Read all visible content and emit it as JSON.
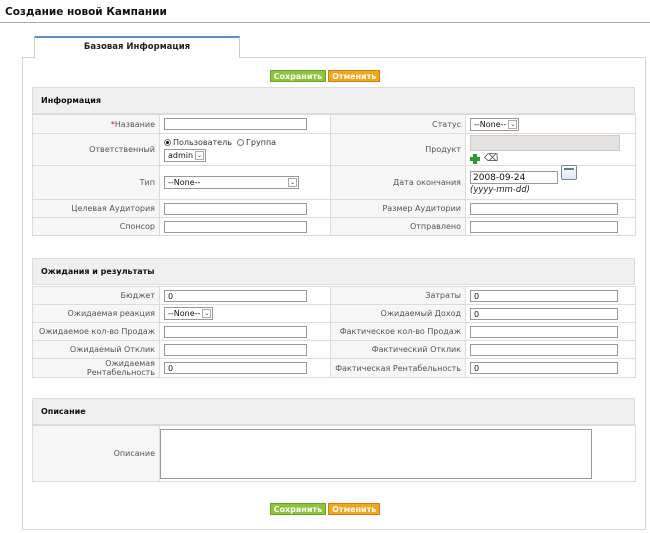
{
  "page": {
    "title": "Создание новой Кампании"
  },
  "tab": {
    "label": "Базовая Информация"
  },
  "buttons": {
    "save_label": "Сохранить",
    "cancel_label": "Отменить"
  },
  "info_section": {
    "title": "Информация",
    "required_marker": "*",
    "name_label": "Название",
    "name_value": "",
    "status_label": "Статус",
    "status_value": "--None--",
    "assigned_label": "Ответственный",
    "radio_user_label": "Пользователь",
    "radio_group_label": "Группа",
    "assigned_value": "admin",
    "product_label": "Продукт",
    "type_label": "Тип",
    "type_value": "--None--",
    "end_date_label": "Дата окончания",
    "end_date_value": "2008-09-24",
    "end_date_format": "(yyyy-mm-dd)",
    "target_audience_label": "Целевая Аудитория",
    "target_audience_value": "",
    "audience_size_label": "Размер Аудитории",
    "audience_size_value": "",
    "sponsor_label": "Спонсор",
    "sponsor_value": "",
    "sent_label": "Отправлено",
    "sent_value": ""
  },
  "expect_section": {
    "title": "Ожидания и результаты",
    "budget_label": "Бюджет",
    "budget_value": "0",
    "cost_label": "Затраты",
    "cost_value": "0",
    "expected_response_label": "Ожидаемая реакция",
    "expected_response_value": "--None--",
    "expected_revenue_label": "Ожидаемый Доход",
    "expected_revenue_value": "0",
    "expected_sales_label": "Ожидаемое кол-во Продаж",
    "expected_sales_value": "",
    "actual_sales_label": "Фактическое кол-во Продаж",
    "actual_sales_value": "",
    "expected_reply_label": "Ожидаемый Отклик",
    "expected_reply_value": "",
    "actual_reply_label": "Фактический Отклик",
    "actual_reply_value": "",
    "expected_roi_label": "Ожидаемая Рентабельность",
    "expected_roi_value": "0",
    "actual_roi_label": "Фактическая Рентабельность",
    "actual_roi_value": "0"
  },
  "desc_section": {
    "title": "Описание",
    "description_label": "Описание",
    "description_value": ""
  },
  "icons": {
    "add": "plus-icon",
    "clear": "eraser-icon",
    "calendar": "calendar-icon",
    "dropdown": "chevron-down-icon"
  }
}
